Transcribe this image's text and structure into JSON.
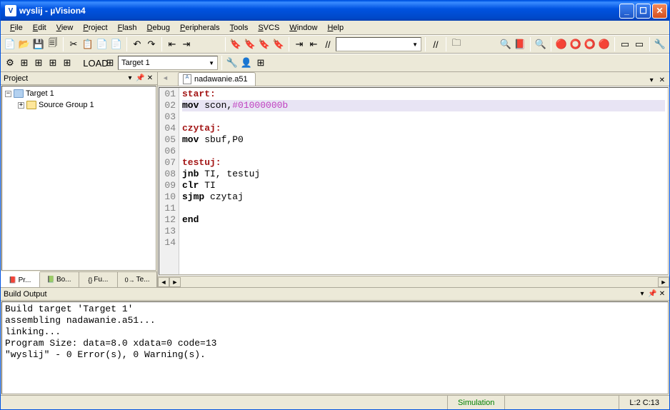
{
  "titlebar": {
    "icon": "V",
    "text": "wyslij  - µVision4"
  },
  "menu": [
    "File",
    "Edit",
    "View",
    "Project",
    "Flash",
    "Debug",
    "Peripherals",
    "Tools",
    "SVCS",
    "Window",
    "Help"
  ],
  "targetCombo": "Target 1",
  "projectPanel": {
    "title": "Project",
    "tree": {
      "root": {
        "exp": "−",
        "label": "Target 1"
      },
      "child": {
        "exp": "+",
        "label": "Source Group 1"
      }
    },
    "tabs": [
      "Pr...",
      "Bo...",
      "Fu...",
      "Te..."
    ],
    "tabPrefixes": [
      "📕",
      "📗",
      "{}",
      "0→"
    ]
  },
  "editor": {
    "tab": "nadawanie.a51",
    "lines": [
      {
        "n": "01",
        "t": "label",
        "text": "start:"
      },
      {
        "n": "02",
        "t": "code",
        "hl": true,
        "inst": "mov",
        "args": " scon,",
        "lit": "#01000000b"
      },
      {
        "n": "03",
        "t": "blank"
      },
      {
        "n": "04",
        "t": "label",
        "text": "czytaj:"
      },
      {
        "n": "05",
        "t": "code",
        "inst": "mov",
        "args": " sbuf,P0"
      },
      {
        "n": "06",
        "t": "blank"
      },
      {
        "n": "07",
        "t": "label",
        "text": "testuj:"
      },
      {
        "n": "08",
        "t": "code",
        "inst": "jnb",
        "args": " TI, testuj"
      },
      {
        "n": "09",
        "t": "code",
        "inst": "clr",
        "args": " TI"
      },
      {
        "n": "10",
        "t": "code",
        "inst": "sjmp",
        "args": " czytaj"
      },
      {
        "n": "11",
        "t": "blank"
      },
      {
        "n": "12",
        "t": "code",
        "inst": "end",
        "args": ""
      },
      {
        "n": "13",
        "t": "blank"
      },
      {
        "n": "14",
        "t": "blank"
      }
    ]
  },
  "build": {
    "title": "Build Output",
    "text": "Build target 'Target 1'\nassembling nadawanie.a51...\nlinking...\nProgram Size: data=8.0 xdata=0 code=13\n\"wyslij\" - 0 Error(s), 0 Warning(s)."
  },
  "status": {
    "sim": "Simulation",
    "pos": "L:2 C:13"
  },
  "icons": {
    "toolbar1": [
      "📄",
      "📂",
      "💾",
      "🗐",
      "|",
      "✂",
      "📋",
      "📄",
      "📄",
      "|",
      "↶",
      "↷",
      "|",
      "⇤",
      "⇥",
      "",
      "",
      "|",
      "🔖",
      "🔖",
      "🔖",
      "🔖",
      "|",
      "⇥",
      "⇤",
      "//",
      "//",
      "|",
      "🗀"
    ],
    "toolbar1b": [
      "🔍",
      "📕",
      "|",
      "🔍",
      "|",
      "🔴",
      "⭕",
      "⭕",
      "🔴",
      "|",
      "▭",
      "▭",
      "|",
      "🔧"
    ],
    "toolbar2": [
      "⚙",
      "⊞",
      "⊞",
      "⊞",
      "⊞",
      "",
      "LOAD",
      "⊞"
    ],
    "toolbar2b": [
      "🔧",
      "👤",
      "⊞"
    ]
  }
}
